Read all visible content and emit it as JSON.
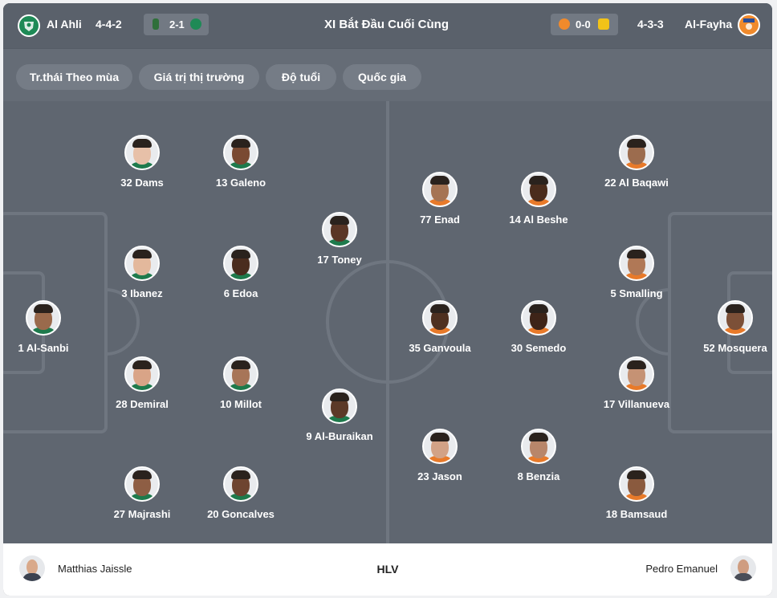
{
  "header": {
    "home_team": "Al Ahli",
    "home_formation": "4-4-2",
    "home_last_score": "2-1",
    "title": "XI Bắt Đầu Cuối Cùng",
    "away_last_score": "0-0",
    "away_formation": "4-3-3",
    "away_team": "Al-Fayha"
  },
  "filters": [
    "Tr.thái Theo mùa",
    "Giá trị thị trường",
    "Độ tuổi",
    "Quốc gia"
  ],
  "home_players": [
    {
      "label": "1 Al-Sanbi",
      "skin": "#9a6a4c"
    },
    {
      "label": "32 Dams",
      "skin": "#e7c0a8"
    },
    {
      "label": "3 Ibanez",
      "skin": "#e3b89c"
    },
    {
      "label": "28 Demiral",
      "skin": "#d9a487"
    },
    {
      "label": "27 Majrashi",
      "skin": "#8e5e44"
    },
    {
      "label": "13 Galeno",
      "skin": "#7a4a32"
    },
    {
      "label": "6 Edoa",
      "skin": "#4a2c1e"
    },
    {
      "label": "10 Millot",
      "skin": "#a77558"
    },
    {
      "label": "20 Goncalves",
      "skin": "#6e4430"
    },
    {
      "label": "17 Toney",
      "skin": "#5a3626"
    },
    {
      "label": "9 Al-Buraikan",
      "skin": "#5c3a28"
    }
  ],
  "away_players": [
    {
      "label": "52 Mosquera",
      "skin": "#7c5038"
    },
    {
      "label": "22 Al Baqawi",
      "skin": "#9c6c4e"
    },
    {
      "label": "5 Smalling",
      "skin": "#b07856"
    },
    {
      "label": "17 Villanueva",
      "skin": "#c59274"
    },
    {
      "label": "18 Bamsaud",
      "skin": "#8a5a3e"
    },
    {
      "label": "77 Enad",
      "skin": "#a57454"
    },
    {
      "label": "35 Ganvoula",
      "skin": "#4e3020"
    },
    {
      "label": "23 Jason",
      "skin": "#d2a286"
    },
    {
      "label": "14 Al Beshe",
      "skin": "#4a2c1c"
    },
    {
      "label": "30 Semedo",
      "skin": "#3e2418"
    },
    {
      "label": "8 Benzia",
      "skin": "#b8866a"
    }
  ],
  "coaches": {
    "home": "Matthias Jaissle",
    "label": "HLV",
    "away": "Pedro Emanuel"
  },
  "colors": {
    "pitch": "#5f6670",
    "home_shirt": "#1e7a4c",
    "away_shirt": "#e87a2a",
    "home_crest": "#1e8a56",
    "away_crest": "#f08a2c"
  },
  "icons": {
    "home_crest": "al-ahli-crest-icon",
    "away_crest": "al-fayha-crest-icon"
  }
}
